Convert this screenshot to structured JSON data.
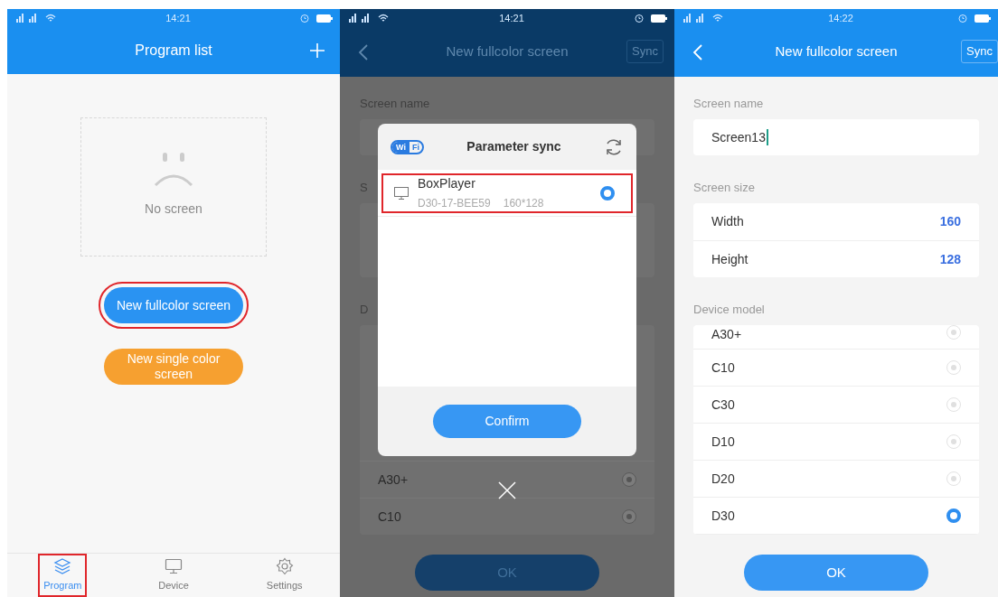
{
  "program_list_screen": {
    "status_time": "14:21",
    "title": "Program list",
    "empty_state": "No screen",
    "buttons": [
      {
        "label": "New fullcolor screen",
        "kind": "primary",
        "highlighted": true
      },
      {
        "label": "New single color screen",
        "kind": "secondary",
        "highlighted": false
      }
    ],
    "tab_bar": [
      {
        "label": "Program",
        "selected": true,
        "highlighted": true
      },
      {
        "label": "Device",
        "selected": false,
        "highlighted": false
      },
      {
        "label": "Settings",
        "selected": false,
        "highlighted": false
      }
    ]
  },
  "sync_dialog_screen": {
    "status_time": "14:21",
    "title": "New fullcolor screen",
    "sync_button": "Sync",
    "background": {
      "screen_name_label": "Screen name",
      "section_2_label": "S",
      "section_3_label": "D",
      "models": [
        {
          "label": "A30+",
          "selected": false
        },
        {
          "label": "C10",
          "selected": false
        }
      ],
      "ok_button": "OK"
    },
    "dialog": {
      "wifi_badge": [
        "Wi",
        "Fi"
      ],
      "title": "Parameter sync",
      "devices": [
        {
          "name": "BoxPlayer",
          "id": "D30-17-BEE59",
          "size": "160*128",
          "selected": true,
          "highlighted": true
        }
      ],
      "confirm_button": "Confirm"
    }
  },
  "new_screen_form": {
    "status_time": "14:22",
    "title": "New fullcolor screen",
    "sync_button": "Sync",
    "screen_name_label": "Screen name",
    "screen_name_value": "Screen13",
    "screen_size_label": "Screen size",
    "size_rows": [
      {
        "label": "Width",
        "value": "160"
      },
      {
        "label": "Height",
        "value": "128"
      }
    ],
    "device_model_label": "Device model",
    "models": [
      {
        "label": "A30+",
        "selected": false
      },
      {
        "label": "C10",
        "selected": false
      },
      {
        "label": "C30",
        "selected": false
      },
      {
        "label": "D10",
        "selected": false
      },
      {
        "label": "D20",
        "selected": false
      },
      {
        "label": "D30",
        "selected": true
      }
    ],
    "ok_button": "OK"
  }
}
